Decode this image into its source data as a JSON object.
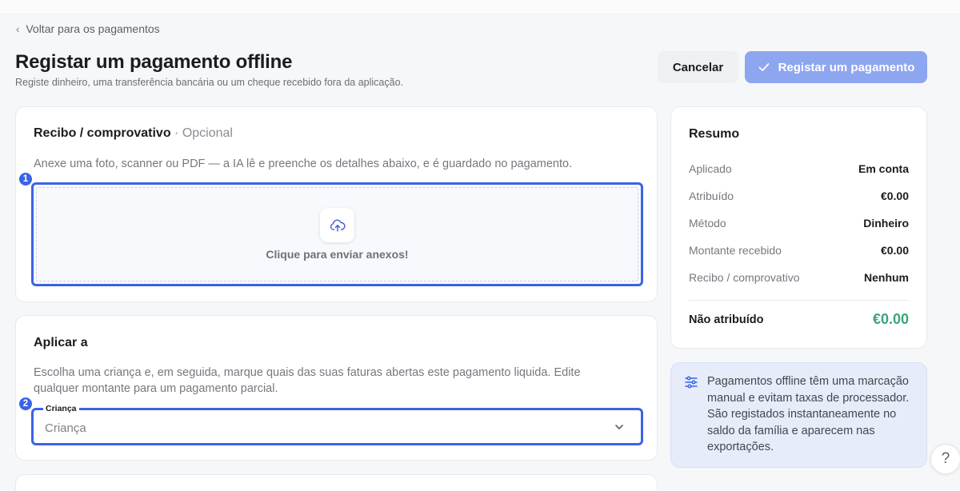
{
  "nav": {
    "back_label": "Voltar para os pagamentos"
  },
  "header": {
    "title": "Registar um pagamento offline",
    "subtitle": "Registe dinheiro, uma transferência bancária ou um cheque recebido fora da aplicação.",
    "cancel_label": "Cancelar",
    "submit_label": "Registar um pagamento"
  },
  "receipt": {
    "title": "Recibo / comprovativo",
    "optional": "· Opcional",
    "description": "Anexe uma foto, scanner ou PDF — a IA lê e preenche os detalhes abaixo, e é guardado no pagamento.",
    "step": "1",
    "upload_label": "Clique para enviar anexos!",
    "upload_icon": "cloud-upload-icon"
  },
  "apply": {
    "title": "Aplicar a",
    "description_line1": "Escolha uma criança e, em seguida, marque quais das suas faturas abertas este pagamento liquida. Edite",
    "description_line2": "qualquer montante para um pagamento parcial.",
    "step": "2",
    "field_label": "Criança",
    "field_placeholder": "Criança"
  },
  "summary": {
    "title": "Resumo",
    "rows": [
      {
        "label": "Aplicado",
        "value": "Em conta"
      },
      {
        "label": "Atribuído",
        "value": "€0.00"
      },
      {
        "label": "Método",
        "value": "Dinheiro"
      },
      {
        "label": "Montante recebido",
        "value": "€0.00"
      },
      {
        "label": "Recibo / comprovativo",
        "value": "Nenhum"
      }
    ],
    "total_label": "Não atribuído",
    "total_value": "€0.00"
  },
  "info": {
    "text": "Pagamentos offline têm uma marcação manual e evitam taxas de processador. São registados instantaneamente no saldo da família e aparecem nas exportações."
  },
  "help": {
    "label": "?"
  },
  "colors": {
    "accent": "#3b63e6",
    "primary_disabled": "#8ea5f0",
    "success": "#3aa578",
    "info_bg": "#e7ecfb"
  }
}
